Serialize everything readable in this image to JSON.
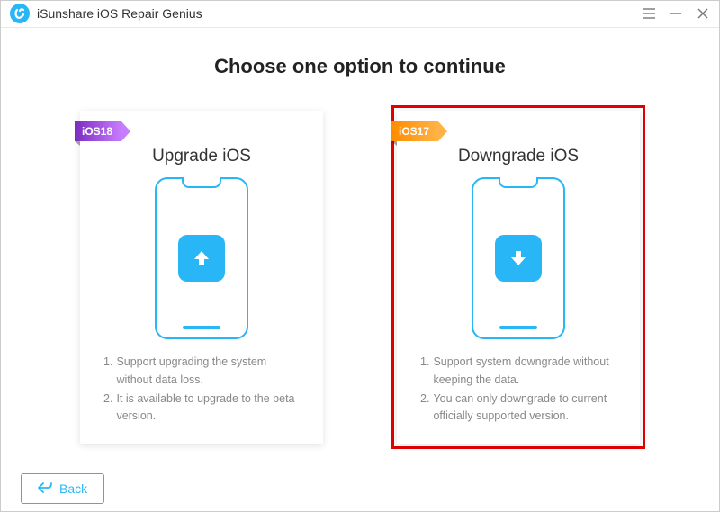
{
  "app": {
    "title": "iSunshare iOS Repair Genius"
  },
  "heading": "Choose one option to continue",
  "cards": {
    "upgrade": {
      "ribbon": "iOS18",
      "title": "Upgrade iOS",
      "desc1": "Support upgrading the system without data loss.",
      "desc2": "It is available to upgrade to the beta version."
    },
    "downgrade": {
      "ribbon": "iOS17",
      "title": "Downgrade iOS",
      "desc1": "Support system downgrade without keeping the data.",
      "desc2": "You can only downgrade to current officially supported version."
    }
  },
  "footer": {
    "back": "Back"
  }
}
